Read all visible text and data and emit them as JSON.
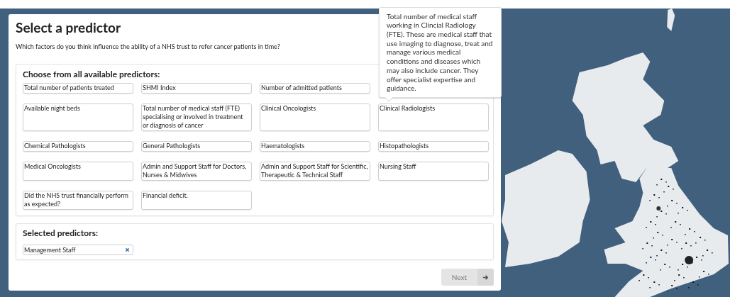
{
  "title": "Select a predictor",
  "question": "Which factors do you think influence the ability of a NHS trust to refer cancer patients in time?",
  "available": {
    "heading": "Choose from all available predictors:",
    "rows": [
      [
        {
          "label": "Total number of patients treated"
        },
        {
          "label": "SHMI Index"
        },
        {
          "label": "Number of admitted patients"
        }
      ],
      [
        {
          "label": "Available night beds"
        },
        {
          "label": "Total number of medical staff (FTE) specialising or involved in treatment or diagnosis of cancer"
        },
        {
          "label": "Clinical Oncologists"
        },
        {
          "label": "Clinical Radiologists",
          "tooltip": "Total number of medical staff working in Clincial Radiology (FTE). These are medical staff that use imaging to diagnose, treat and manage various medical conditions and diseases which may also include cancer. They offer specialist expertise and guidance."
        }
      ],
      [
        {
          "label": "Chemical Pathologists"
        },
        {
          "label": "General Pathologists"
        },
        {
          "label": "Haematologists"
        },
        {
          "label": "Histopathologists"
        }
      ],
      [
        {
          "label": "Medical Oncologists"
        },
        {
          "label": "Admin and Support Staff for Doctors, Nurses & Midwives"
        },
        {
          "label": "Admin and Support Staff for Scientific, Therapeutic & Technical Staff"
        },
        {
          "label": "Nursing Staff"
        }
      ],
      [
        {
          "label": "Did the NHS trust financially perform as expected?"
        },
        {
          "label": "Financial deficit."
        }
      ]
    ]
  },
  "selected": {
    "heading": "Selected predictors:",
    "items": [
      {
        "label": "Management Staff"
      }
    ]
  },
  "next_button": {
    "label": "Next",
    "disabled": true
  }
}
